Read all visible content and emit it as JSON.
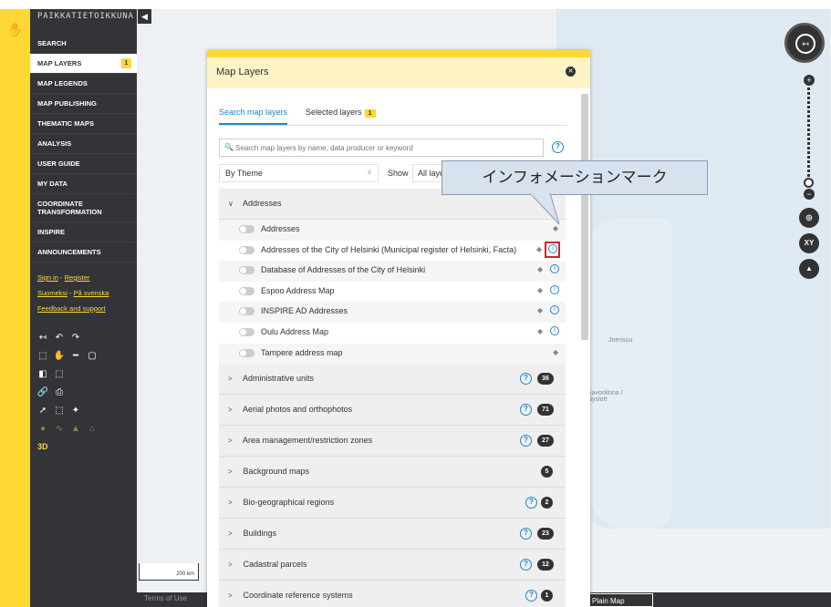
{
  "app": {
    "brand": "PAIKKATIETOIKKUNA"
  },
  "sidebar": {
    "items": [
      {
        "label": "SEARCH"
      },
      {
        "label": "MAP LAYERS",
        "badge": "1",
        "active": true
      },
      {
        "label": "MAP LEGENDS"
      },
      {
        "label": "MAP PUBLISHING"
      },
      {
        "label": "THEMATIC MAPS"
      },
      {
        "label": "ANALYSIS"
      },
      {
        "label": "USER GUIDE"
      },
      {
        "label": "MY DATA"
      },
      {
        "label": "COORDINATE TRANSFORMATION"
      },
      {
        "label": "INSPIRE"
      },
      {
        "label": "ANNOUNCEMENTS"
      }
    ],
    "links": {
      "sign_in": "Sign in",
      "separator": " - ",
      "register": "Register",
      "suomeksi": "Suomeksi",
      "pa_svenska": "På svenska",
      "feedback": "Feedback and support"
    },
    "three_d": "3D"
  },
  "panel": {
    "title": "Map Layers",
    "tabs": {
      "search": "Search map layers",
      "selected": "Selected layers",
      "selected_count": "1"
    },
    "search": {
      "placeholder": "Search map layers by name, data producer or keyword"
    },
    "filter": {
      "theme_value": "By Theme",
      "show_label": "Show",
      "show_value": "All layers"
    },
    "expanded_group": {
      "name": "Addresses",
      "layers": [
        {
          "name": "Addresses",
          "info": false
        },
        {
          "name": "Addresses of the City of Helsinki (Municipal register of Helsinki, Facta)",
          "info": true,
          "highlighted": true
        },
        {
          "name": "Database of Addresses of the City of Helsinki",
          "info": true
        },
        {
          "name": "Espoo Address Map",
          "info": true
        },
        {
          "name": "INSPIRE AD Addresses",
          "info": true
        },
        {
          "name": "Oulu Address Map",
          "info": true
        },
        {
          "name": "Tampere address map",
          "info": false
        }
      ]
    },
    "groups": [
      {
        "name": "Administrative units",
        "count": "36",
        "help": true
      },
      {
        "name": "Aerial photos and orthophotos",
        "count": "71",
        "help": true
      },
      {
        "name": "Area management/restriction zones",
        "count": "27",
        "help": true
      },
      {
        "name": "Background maps",
        "count": "5",
        "help": false
      },
      {
        "name": "Bio-geographical regions",
        "count": "2",
        "help": true
      },
      {
        "name": "Buildings",
        "count": "23",
        "help": true
      },
      {
        "name": "Cadastral parcels",
        "count": "12",
        "help": true
      },
      {
        "name": "Coordinate reference systems",
        "count": "1",
        "help": true
      }
    ]
  },
  "callout": {
    "text": "インフォメーションマーク"
  },
  "map": {
    "scale": "200 km",
    "terms": "Terms of Use",
    "plain_map": "Plain Map",
    "labels": {
      "joensuu": "Joensuu",
      "savonlinna": "Savonlinna / Nyslott"
    },
    "xy_button": "XY"
  },
  "colors": {
    "brand_yellow": "#fdd835",
    "sidebar_dark": "#333438",
    "link_blue": "#1e88c8",
    "highlight_red": "#c62828"
  },
  "icons": [
    "back-icon",
    "undo-icon",
    "redo-icon",
    "zoom-box-icon",
    "pan-icon",
    "measure-line-icon",
    "measure-area-icon",
    "print-icon",
    "link-icon",
    "close-icon",
    "help-icon",
    "info-icon",
    "layer-stack-icon",
    "compass-icon",
    "locate-icon",
    "north-arrow-icon"
  ]
}
